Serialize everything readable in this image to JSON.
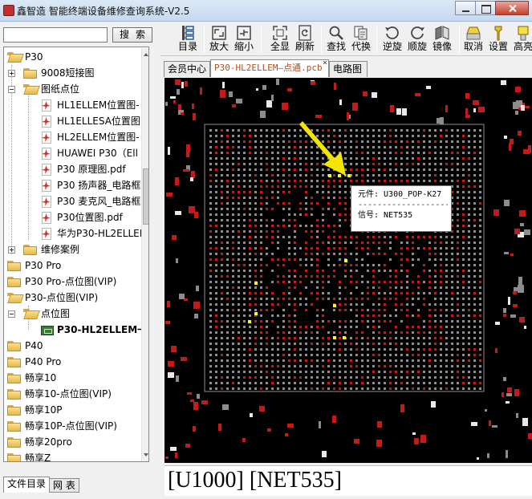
{
  "window": {
    "title": "鑫智造 智能终端设备维修查询系统-V2.5"
  },
  "search": {
    "placeholder": "",
    "value": "",
    "button_label": "搜索"
  },
  "tree": {
    "items": [
      {
        "label": "P30"
      },
      {
        "label": "9008短接图"
      },
      {
        "label": "图纸点位"
      },
      {
        "label": "HL1ELLEM位置图-"
      },
      {
        "label": "HL1ELLESA位置图"
      },
      {
        "label": "HL2ELLEM位置图-"
      },
      {
        "label": "HUAWEI P30（Ell"
      },
      {
        "label": "P30 原理图.pdf"
      },
      {
        "label": "P30 扬声器_电路框"
      },
      {
        "label": "P30 麦克风_电路框"
      },
      {
        "label": "P30位置图.pdf"
      },
      {
        "label": "华为P30-HL2ELLEI"
      },
      {
        "label": "维修案例"
      },
      {
        "label": "P30 Pro"
      },
      {
        "label": "P30 Pro-点位图(VIP)"
      },
      {
        "label": "P30-点位图(VIP)"
      },
      {
        "label": "点位图"
      },
      {
        "label": "P30-HL2ELLEM一"
      },
      {
        "label": "P40"
      },
      {
        "label": "P40 Pro"
      },
      {
        "label": "畅享10"
      },
      {
        "label": "畅享10-点位图(VIP)"
      },
      {
        "label": "畅享10P"
      },
      {
        "label": "畅享10P-点位图(VIP)"
      },
      {
        "label": "畅享20pro"
      },
      {
        "label": "畅享Z"
      }
    ]
  },
  "bottom_tabs": [
    {
      "label": "文件目录"
    },
    {
      "label": "网 表"
    }
  ],
  "toolbar": {
    "buttons": [
      {
        "label": "目录",
        "icon": "catalog-icon"
      },
      {
        "label": "放大",
        "icon": "zoom-in-icon"
      },
      {
        "label": "缩小",
        "icon": "zoom-out-icon"
      },
      {
        "label": "全显",
        "icon": "fit-all-icon"
      },
      {
        "label": "刷新",
        "icon": "refresh-icon"
      },
      {
        "label": "查找",
        "icon": "search-icon"
      },
      {
        "label": "代换",
        "icon": "replace-icon"
      },
      {
        "label": "逆旋",
        "icon": "rotate-ccw-icon"
      },
      {
        "label": "顺旋",
        "icon": "rotate-cw-icon"
      },
      {
        "label": "镜像",
        "icon": "mirror-icon"
      },
      {
        "label": "取消",
        "icon": "eraser-icon"
      },
      {
        "label": "设置",
        "icon": "settings-icon"
      },
      {
        "label": "高亮",
        "icon": "highlight-icon"
      }
    ]
  },
  "doc_tabs": [
    {
      "label": "会员中心"
    },
    {
      "label": "P30-HL2ELLEM—点通.pcb",
      "close": "×"
    },
    {
      "label": "电路图"
    }
  ],
  "info_popup": {
    "component": "元件: U300_POP-K27",
    "separator": "--------------------",
    "net": "信号: NET535"
  },
  "status": {
    "text": "[U1000]  [NET535]"
  },
  "colors": {
    "board_bg": "#000000",
    "pad_red": "#c41a1a",
    "pad_gray": "#8c8c8c",
    "highlight": "#ffff00",
    "arrow": "#f2e600"
  }
}
